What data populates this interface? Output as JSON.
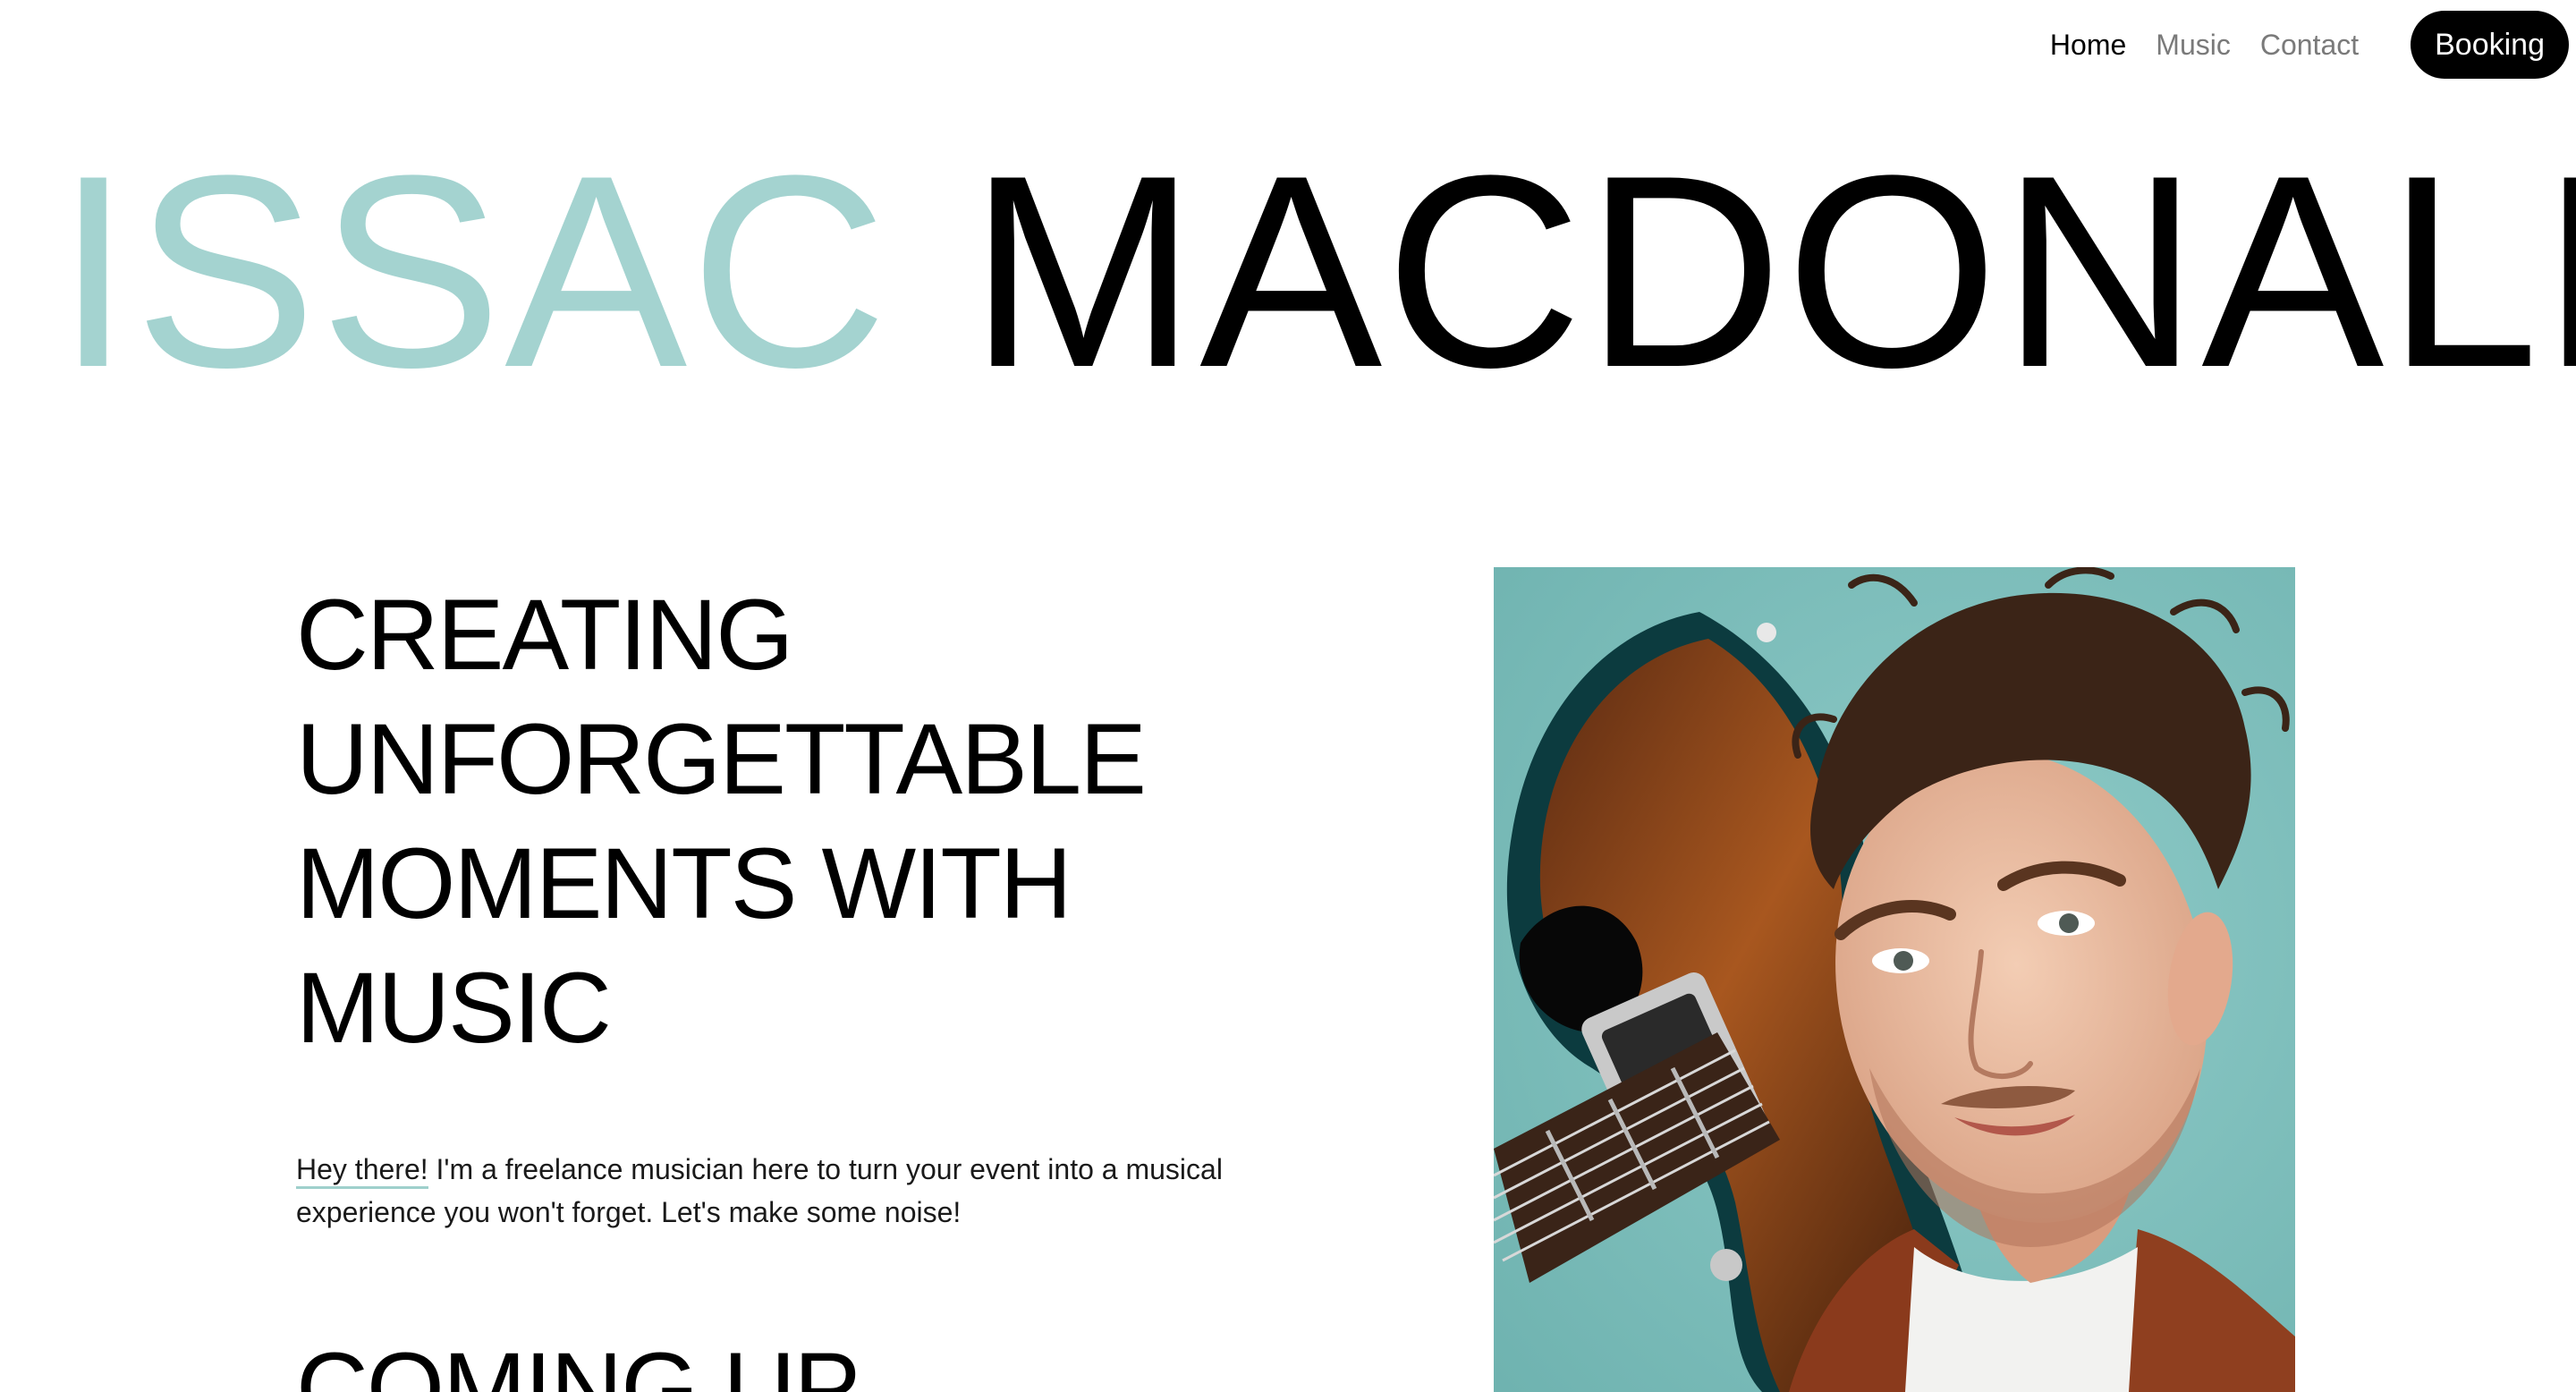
{
  "nav": {
    "links": [
      {
        "label": "Home",
        "active": true
      },
      {
        "label": "Music",
        "active": false
      },
      {
        "label": "Contact",
        "active": false
      }
    ],
    "cta_label": "Booking"
  },
  "hero": {
    "first_name": "ISSAC",
    "last_name": "MACDONALD",
    "first_name_color": "#a4d3d0",
    "last_name_color": "#000000"
  },
  "main": {
    "tagline": "CREATING UNFORGETTABLE MOMENTS WITH MUSIC",
    "intro": {
      "link_text": "Hey there!",
      "body_text": " I'm a freelance musician here to turn your event into a musical experience you won't forget. Let's make some noise!"
    },
    "section_heading": "COMING UP"
  },
  "colors": {
    "accent": "#a4d3d0",
    "background": "#ffffff",
    "button": "#000000"
  }
}
